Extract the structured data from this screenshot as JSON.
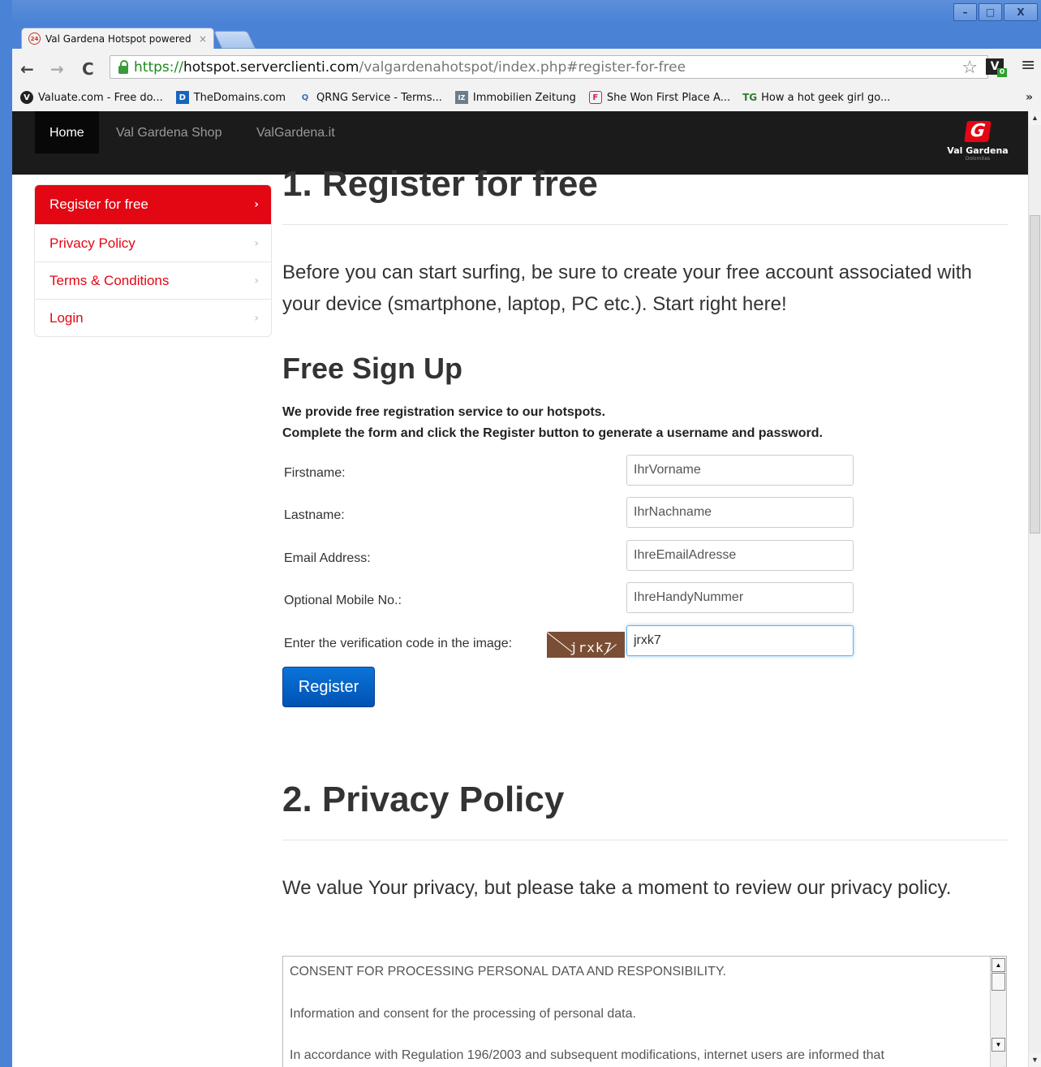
{
  "browser": {
    "tab_title": "Val Gardena Hotspot powered",
    "tab_favicon": "24",
    "tab_close": "×",
    "url_scheme": "https://",
    "url_host": "hotspot.serverclienti.com",
    "url_path": "/valgardenahotspot/index.php#register-for-free",
    "extension_label": "V",
    "extension_badge": "0",
    "bookmarks": [
      {
        "label": "Valuate.com - Free do...",
        "icon": "V"
      },
      {
        "label": "TheDomains.com",
        "icon": "D"
      },
      {
        "label": "QRNG Service - Terms...",
        "icon": "Q"
      },
      {
        "label": "Immobilien Zeitung",
        "icon": "IZ"
      },
      {
        "label": "She Won First Place A...",
        "icon": "F"
      },
      {
        "label": "How a hot geek girl go...",
        "icon": "TG"
      }
    ],
    "bookmarks_more": "»",
    "window_buttons": {
      "minimize": "–",
      "maximize": "□",
      "close": "X"
    }
  },
  "navbar": {
    "items": [
      {
        "label": "Home"
      },
      {
        "label": "Val Gardena Shop"
      },
      {
        "label": "ValGardena.it"
      }
    ],
    "brand": {
      "mark": "G",
      "name": "Val Gardena",
      "sub": "Dolomites"
    }
  },
  "sidenav": {
    "items": [
      {
        "label": "Register for free"
      },
      {
        "label": "Privacy Policy"
      },
      {
        "label": "Terms & Conditions"
      },
      {
        "label": "Login"
      }
    ],
    "chevron": "›"
  },
  "section1": {
    "title": "1. Register for free",
    "lead": "Before you can start surfing, be sure to create your free account associated with your device (smartphone, laptop, PC etc.). Start right here!",
    "signup_title": "Free Sign Up",
    "intro_line1": "We provide free registration service to our hotspots.",
    "intro_line2": "Complete the form and click the Register button to generate a username and password.",
    "fields": {
      "firstname": {
        "label": "Firstname:",
        "placeholder": "IhrVorname"
      },
      "lastname": {
        "label": "Lastname:",
        "placeholder": "IhrNachname"
      },
      "email": {
        "label": "Email Address:",
        "placeholder": "IhreEmailAdresse"
      },
      "mobile": {
        "label": "Optional Mobile No.:",
        "placeholder": "IhreHandyNummer"
      },
      "captcha": {
        "label": "Enter the verification code in the image:",
        "image_text": "jrxk7",
        "value": "jrxk7"
      }
    },
    "register_label": "Register"
  },
  "section2": {
    "title": "2. Privacy Policy",
    "lead": "We value Your privacy, but please take a moment to review our privacy policy.",
    "policy_lines": [
      "CONSENT FOR PROCESSING PERSONAL DATA AND RESPONSIBILITY.",
      "Information and consent for the processing of personal data.",
      "In accordance with Regulation 196/2003 and subsequent modifications, internet users are informed that"
    ]
  }
}
